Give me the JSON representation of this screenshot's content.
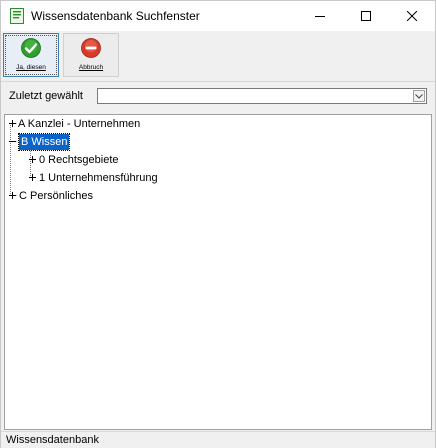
{
  "window": {
    "title": "Wissensdatenbank Suchfenster"
  },
  "toolbar": {
    "ok_label": "Ja, diesen",
    "cancel_label": "Abbruch"
  },
  "recent": {
    "label": "Zuletzt gewählt",
    "value": ""
  },
  "tree": {
    "nodes": [
      {
        "label": "A Kanzlei - Unternehmen"
      },
      {
        "label": "B Wissen",
        "selected": true
      },
      {
        "label": "0 Rechtsgebiete"
      },
      {
        "label": "1 Unternehmensführung"
      },
      {
        "label": "C Persönliches"
      }
    ]
  },
  "status": {
    "text": "Wissensdatenbank"
  },
  "colors": {
    "selection": "#0a64c8",
    "ok_green": "#2f9e2f",
    "cancel_red": "#d83a2a"
  }
}
